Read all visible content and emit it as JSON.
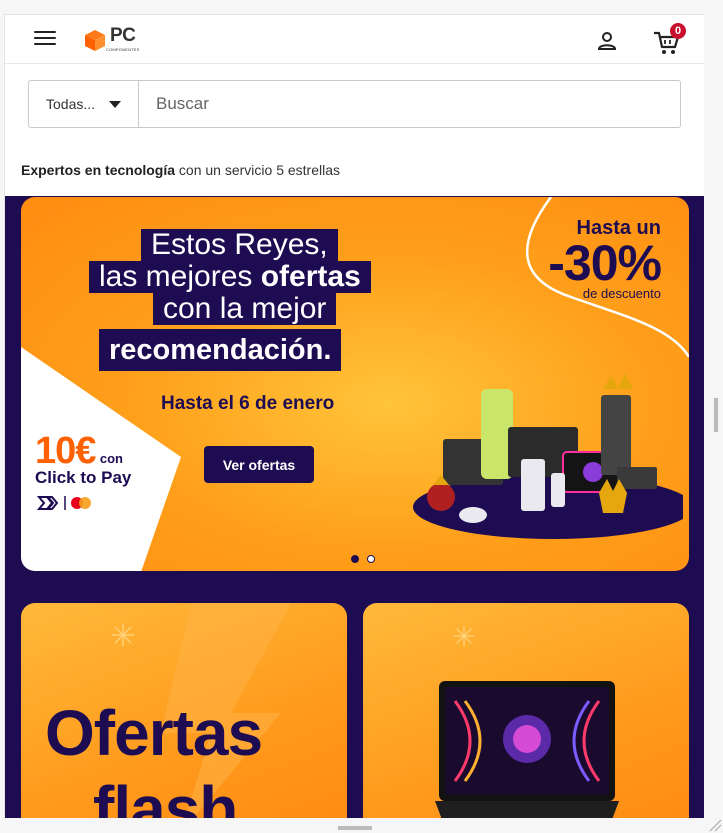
{
  "header": {
    "logo_text": "PC",
    "logo_sub": "COMPONENTES",
    "cart_count": "0",
    "icons": [
      "hamburger-icon",
      "user-icon",
      "cart-icon"
    ]
  },
  "search": {
    "category_label": "Todas...",
    "placeholder": "Buscar"
  },
  "tagline": {
    "bold": "Expertos en tecnología",
    "rest": " con un servicio 5 estrellas"
  },
  "hero": {
    "title_lines": [
      "Estos Reyes,",
      "las mejores ofertas",
      "con la mejor",
      "recomendación."
    ],
    "until": "Hasta el 6 de enero",
    "cta_label": "Ver ofertas",
    "discount_prefix": "Hasta un",
    "discount_value": "-30%",
    "discount_suffix": "de descuento",
    "promo_amount": "10€",
    "promo_con": "con",
    "promo_method": "Click to Pay",
    "active_slide": 1,
    "slide_count": 2
  },
  "cards": {
    "left_text_1": "Ofertas",
    "left_text_2": "flash"
  },
  "colors": {
    "brand_orange": "#ff6000",
    "navy": "#1d0c52",
    "badge_red": "#c8102e"
  }
}
